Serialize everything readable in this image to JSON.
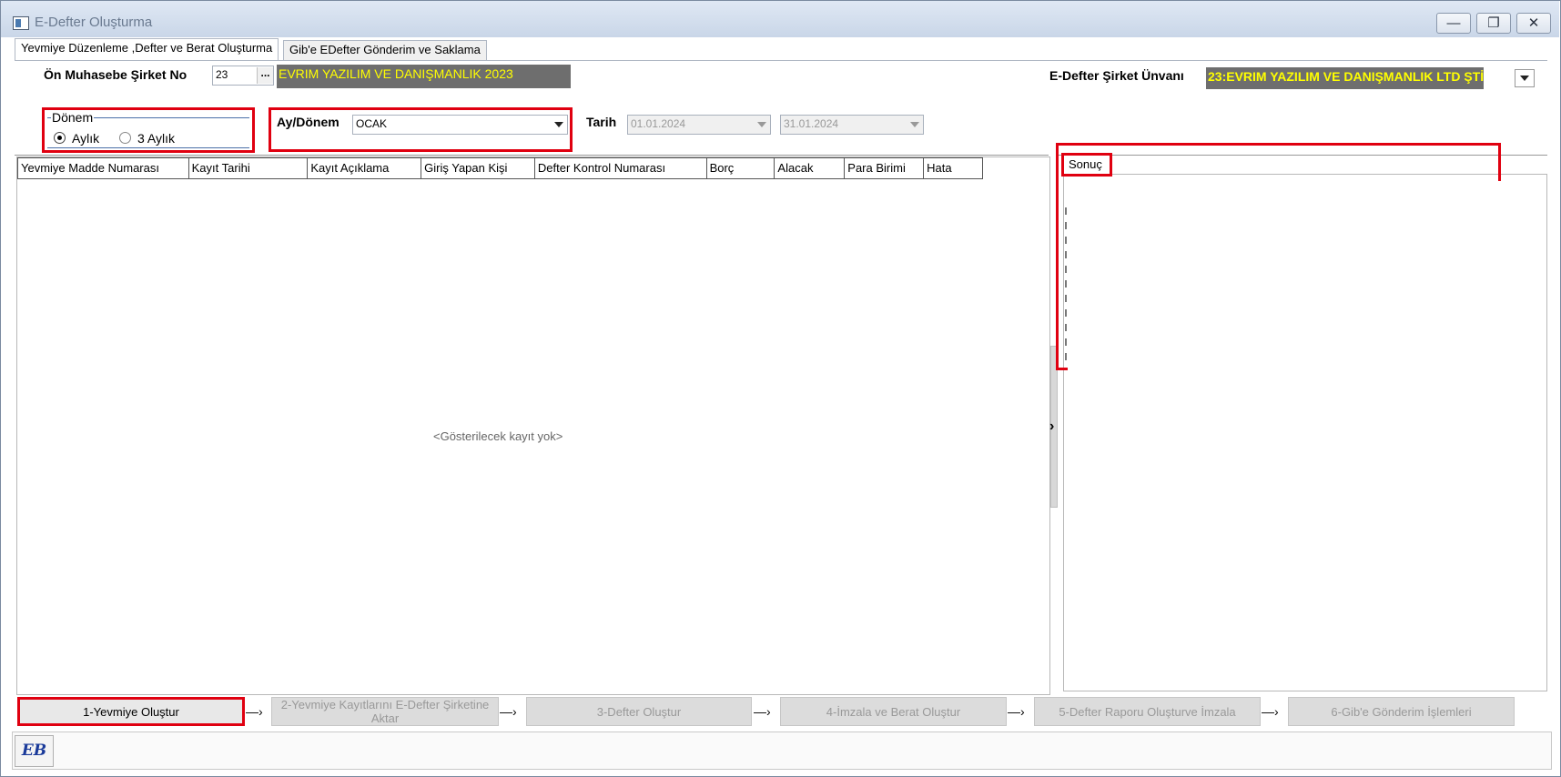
{
  "window": {
    "title": "E-Defter Oluşturma",
    "controls": [
      "minimize-icon",
      "restore-icon",
      "close-icon"
    ]
  },
  "tabs": [
    {
      "label": "Yevmiye Düzenleme ,Defter ve Berat Oluşturma",
      "active": true
    },
    {
      "label": "Gib'e EDefter Gönderim ve Saklama",
      "active": false
    }
  ],
  "company": {
    "label": "Ön Muhasebe Şirket No",
    "number": "23",
    "ellipsis": "...",
    "name": "EVRIM YAZILIM  VE DANIŞMANLIK 2023",
    "edefter_label": "E-Defter Şirket Ünvanı",
    "edefter_value": "23:EVRIM YAZILIM VE DANIŞMANLIK LTD ŞTİ"
  },
  "period": {
    "group_label": "Dönem",
    "options": [
      {
        "label": "Aylık",
        "checked": true
      },
      {
        "label": "3 Aylık",
        "checked": false
      }
    ],
    "month_label": "Ay/Dönem",
    "month_value": "OCAK",
    "date_label": "Tarih",
    "date_from": "01.01.2024",
    "date_to": "31.01.2024"
  },
  "grid": {
    "columns": [
      "Yevmiye Madde Numarası",
      "Kayıt Tarihi",
      "Kayıt Açıklama",
      "Giriş Yapan Kişi",
      "Defter Kontrol Numarası",
      "Borç",
      "Alacak",
      "Para Birimi",
      "Hata"
    ],
    "empty_text": "<Gösterilecek kayıt yok>"
  },
  "result": {
    "tab_label": "Sonuç",
    "first_line": ""
  },
  "splitter_glyph": "›",
  "steps": [
    "1-Yevmiye Oluştur",
    "2-Yevmiye Kayıtlarını E-Defter Şirketine Aktar",
    "3-Defter Oluştur",
    "4-İmzala ve Berat Oluştur",
    "5-Defter Raporu Oluşturve İmzala",
    "6-Gib'e Gönderim İşlemleri"
  ],
  "footer": {
    "logo_text": "EB"
  },
  "colors": {
    "accent_dark": "#6e6e6e",
    "highlight_text": "#ffff00",
    "red_outline": "#e00010"
  }
}
